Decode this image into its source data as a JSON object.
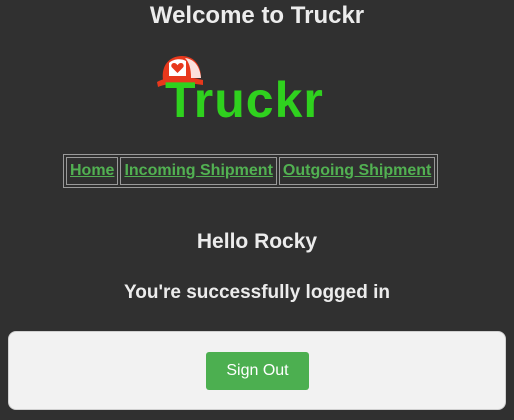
{
  "page": {
    "title": "Welcome to Truckr"
  },
  "logo": {
    "text": "Truckr",
    "icon": "cap-heart-icon",
    "colors": {
      "text": "#2fd11e",
      "cap": "#e8381c"
    }
  },
  "nav": {
    "items": [
      {
        "label": "Home"
      },
      {
        "label": "Incoming Shipment"
      },
      {
        "label": "Outgoing Shipment"
      }
    ]
  },
  "main": {
    "greeting": "Hello Rocky",
    "status": "You're successfully logged in"
  },
  "footer": {
    "signout_label": "Sign Out"
  },
  "colors": {
    "background": "#303030",
    "link": "#52b152",
    "button": "#4caf50"
  }
}
